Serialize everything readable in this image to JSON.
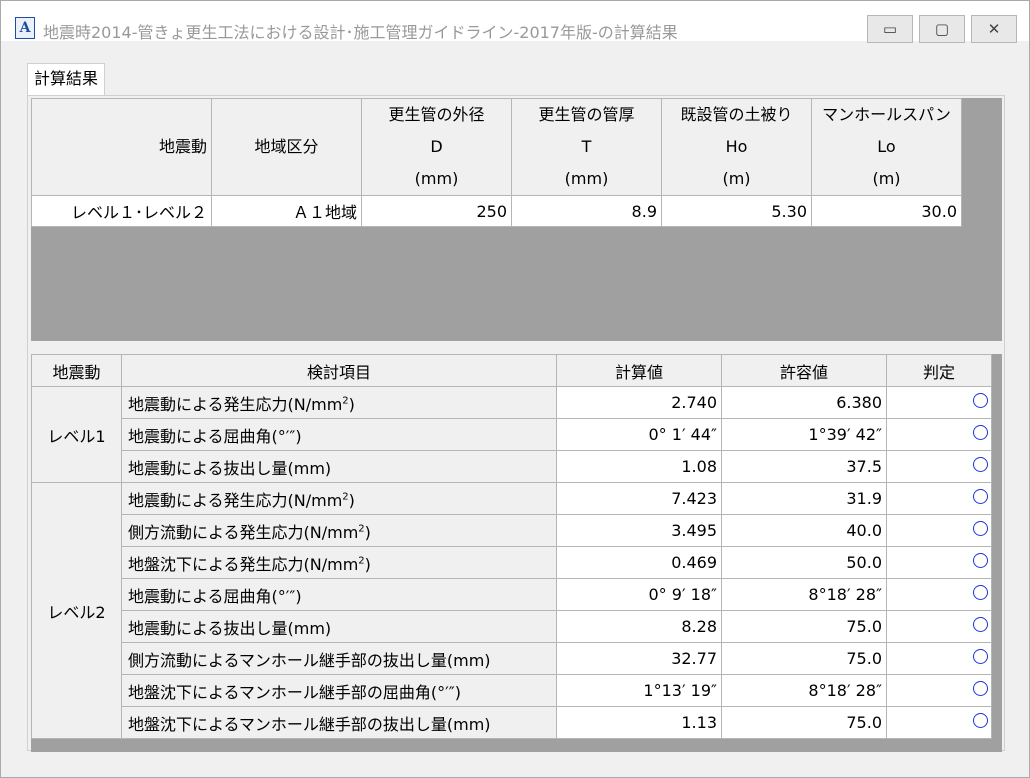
{
  "window": {
    "title": "地震時2014-管きょ更生工法における設計･施工管理ガイドライン-2017年版-の計算結果",
    "controls": {
      "minimize": "▭",
      "maximize": "▢",
      "close": "✕"
    },
    "app_icon": "A"
  },
  "tab": {
    "label": "計算結果"
  },
  "input_table": {
    "headers": [
      {
        "lines": [
          "地震動"
        ]
      },
      {
        "lines": [
          "地域区分"
        ]
      },
      {
        "lines": [
          "更生管の外径",
          "D",
          "(mm)"
        ]
      },
      {
        "lines": [
          "更生管の管厚",
          "T",
          "(mm)"
        ]
      },
      {
        "lines": [
          "既設管の土被り",
          "Ho",
          "(m)"
        ]
      },
      {
        "lines": [
          "マンホールスパン",
          "Lo",
          "(m)"
        ]
      }
    ],
    "row": [
      "レベル１･レベル２",
      "Ａ１地域",
      "250",
      "8.9",
      "5.30",
      "30.0"
    ]
  },
  "result_table": {
    "headers": [
      "地震動",
      "検討項目",
      "計算値",
      "許容値",
      "判定"
    ],
    "levels": [
      "レベル1",
      "レベル2"
    ],
    "rows": [
      {
        "item": "地震動による発生応力(N/mm",
        "sup": "2",
        "tail": ")",
        "calc": "2.740",
        "allow": "6.380",
        "judge": "ok"
      },
      {
        "item": "地震動による屈曲角(°′″)",
        "sup": "",
        "tail": "",
        "calc": "0° 1′ 44″",
        "allow": "1°39′ 42″",
        "judge": "ok"
      },
      {
        "item": "地震動による抜出し量(mm)",
        "sup": "",
        "tail": "",
        "calc": "1.08",
        "allow": "37.5",
        "judge": "ok"
      },
      {
        "item": "地震動による発生応力(N/mm",
        "sup": "2",
        "tail": ")",
        "calc": "7.423",
        "allow": "31.9",
        "judge": "ok"
      },
      {
        "item": "側方流動による発生応力(N/mm",
        "sup": "2",
        "tail": ")",
        "calc": "3.495",
        "allow": "40.0",
        "judge": "ok"
      },
      {
        "item": "地盤沈下による発生応力(N/mm",
        "sup": "2",
        "tail": ")",
        "calc": "0.469",
        "allow": "50.0",
        "judge": "ok"
      },
      {
        "item": "地震動による屈曲角(°′″)",
        "sup": "",
        "tail": "",
        "calc": "0° 9′ 18″",
        "allow": "8°18′ 28″",
        "judge": "ok"
      },
      {
        "item": "地震動による抜出し量(mm)",
        "sup": "",
        "tail": "",
        "calc": "8.28",
        "allow": "75.0",
        "judge": "ok"
      },
      {
        "item": "側方流動によるマンホール継手部の抜出し量(mm)",
        "sup": "",
        "tail": "",
        "calc": "32.77",
        "allow": "75.0",
        "judge": "ok"
      },
      {
        "item": "地盤沈下によるマンホール継手部の屈曲角(°′″)",
        "sup": "",
        "tail": "",
        "calc": "1°13′ 19″",
        "allow": "8°18′ 28″",
        "judge": "ok"
      },
      {
        "item": "地盤沈下によるマンホール継手部の抜出し量(mm)",
        "sup": "",
        "tail": "",
        "calc": "1.13",
        "allow": "75.0",
        "judge": "ok"
      }
    ]
  }
}
